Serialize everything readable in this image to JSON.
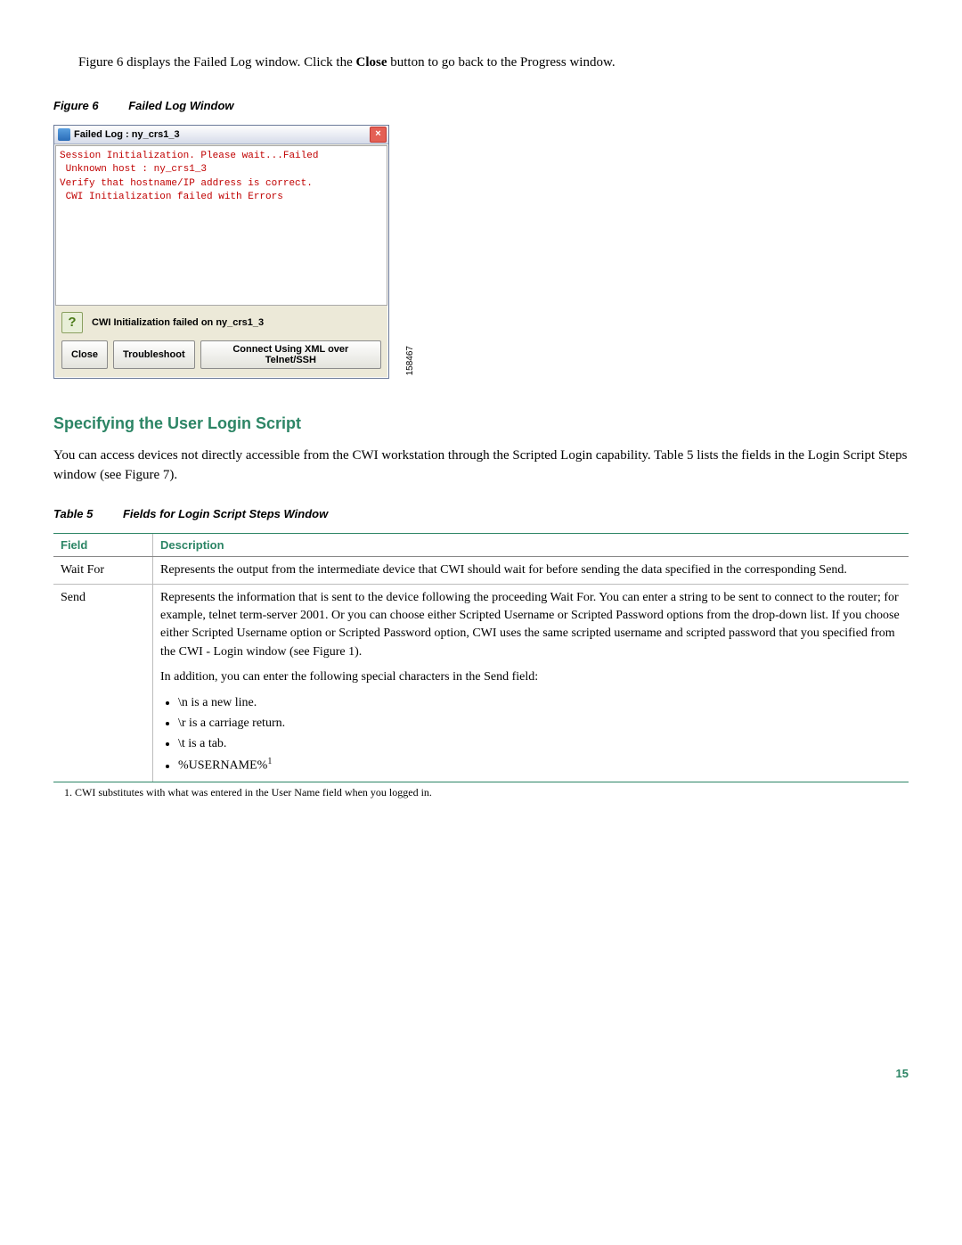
{
  "intro_text": "Figure 6 displays the Failed Log window. Click the Close button to go back to the Progress window.",
  "intro_bold": "Close",
  "figure": {
    "label": "Figure 6",
    "title": "Failed Log Window",
    "window_title": "Failed Log : ny_crs1_3",
    "log_lines": {
      "l1": "Session Initialization. Please wait...Failed",
      "l2": " Unknown host : ny_crs1_3",
      "l3": "Verify that hostname/IP address is correct.",
      "l4": "",
      "l5": " CWI Initialization failed with Errors"
    },
    "status_text": "CWI Initialization failed on ny_crs1_3",
    "buttons": {
      "close": "Close",
      "troubleshoot": "Troubleshoot",
      "connect": "Connect Using XML over Telnet/SSH"
    },
    "side_id": "158467"
  },
  "section": {
    "heading": "Specifying the User Login Script",
    "desc": "You can access devices not directly accessible from the CWI workstation through the Scripted Login capability. Table 5 lists the fields in the Login Script Steps window (see Figure 7)."
  },
  "table": {
    "caption_label": "Table 5",
    "caption_title": "Fields for Login Script Steps Window",
    "headers": {
      "field": "Field",
      "description": "Description"
    },
    "rows": {
      "waitfor": {
        "field": "Wait For",
        "desc": "Represents the output from the intermediate device that CWI should wait for before sending the data specified in the corresponding Send."
      },
      "send": {
        "field": "Send",
        "desc1": "Represents the information that is sent to the device following the proceeding Wait For. You can enter a string to be sent to connect to the router; for example, telnet term-server 2001. Or you can choose either Scripted Username or Scripted Password options from the drop-down list. If you choose either Scripted Username option or Scripted Password option, CWI uses the same scripted username and scripted password that you specified from the CWI - Login window (see Figure 1).",
        "desc2": "In addition, you can enter the following special characters in the Send field:",
        "bullets": {
          "b1": "\\n is a new line.",
          "b2": "\\r is a carriage return.",
          "b3": "\\t is a tab.",
          "b4": "%USERNAME%",
          "b4_sup": "1"
        }
      }
    },
    "footnote": "1. CWI substitutes with what was entered in the User Name field when you logged in."
  },
  "page_number": "15"
}
